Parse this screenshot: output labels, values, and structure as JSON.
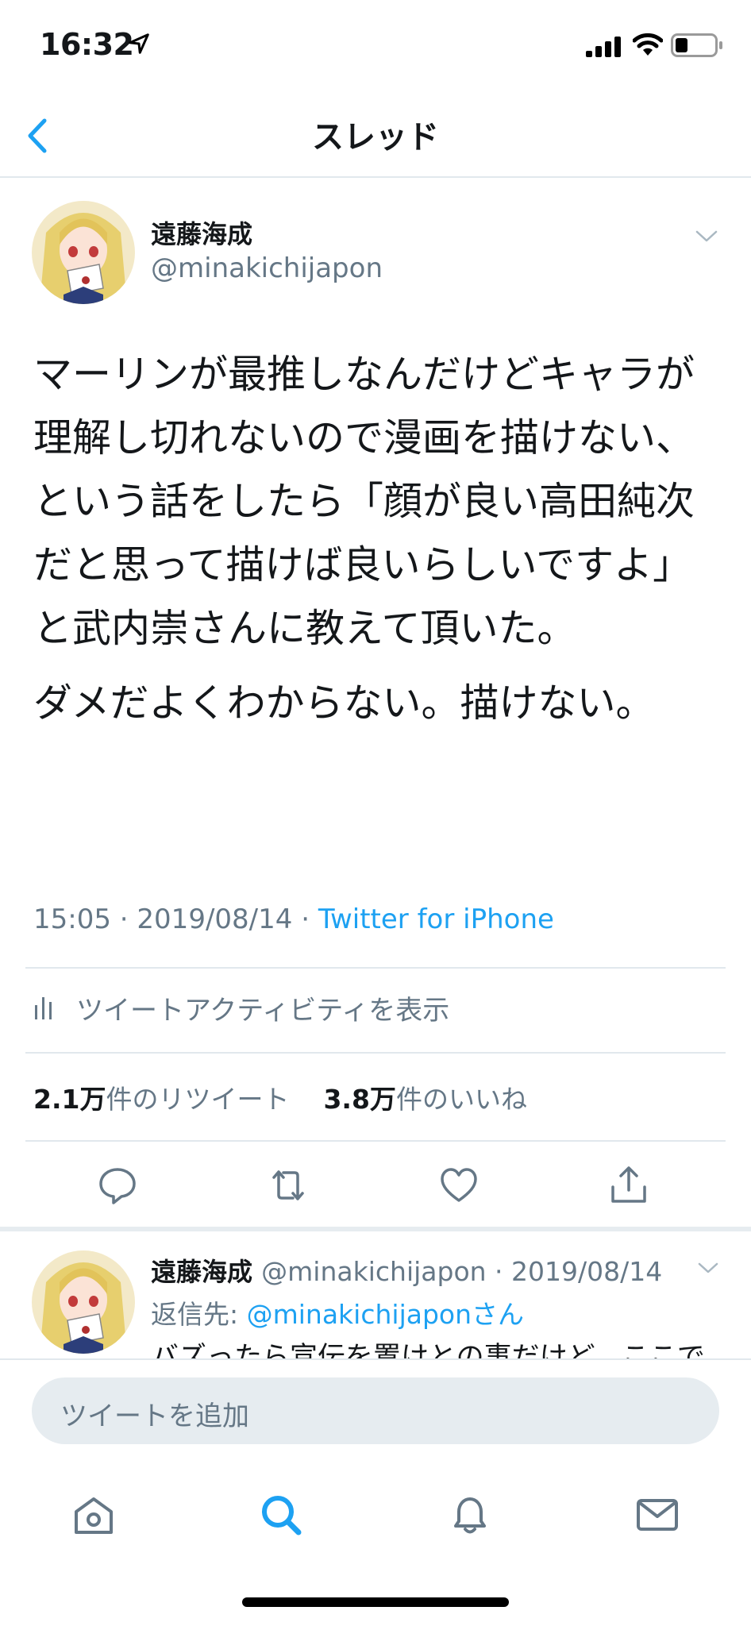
{
  "status_bar": {
    "time": "16:32"
  },
  "nav": {
    "title": "スレッド"
  },
  "tweet": {
    "name": "遠藤海成",
    "handle": "@minakichijapon",
    "paragraphs": [
      "マーリンが最推しなんだけどキャラが理解し切れないので漫画を描けない、という話をしたら「顔が良い高田純次だと思って描けば良いらしいですよ」と武内崇さんに教えて頂いた。",
      "ダメだよくわからない。描けない。"
    ],
    "time": "15:05",
    "date": "2019/08/14",
    "source": "Twitter for iPhone",
    "activity_label": "ツイートアクティビティを表示",
    "retweet_count": "2.1万",
    "retweet_label": "件のリツイート",
    "like_count": "3.8万",
    "like_label": "件のいいね"
  },
  "reply": {
    "name": "遠藤海成",
    "handle": "@minakichijapon",
    "date": "2019/08/14",
    "reply_prefix": "返信先: ",
    "reply_mention": "@minakichijaponさん",
    "text": "バズったら宣伝を置けとの事だけど、ここで"
  },
  "compose": {
    "placeholder": "ツイートを追加"
  },
  "colors": {
    "accent": "#1da1f2",
    "secondary_text": "#657786",
    "divider": "#e1e8ed"
  },
  "icons": [
    "location-arrow-icon",
    "signal-icon",
    "wifi-icon",
    "battery-icon",
    "back-chevron-icon",
    "chevron-down-icon",
    "analytics-icon",
    "reply-icon",
    "retweet-icon",
    "like-icon",
    "share-icon",
    "home-icon",
    "search-icon",
    "notifications-icon",
    "messages-icon"
  ]
}
